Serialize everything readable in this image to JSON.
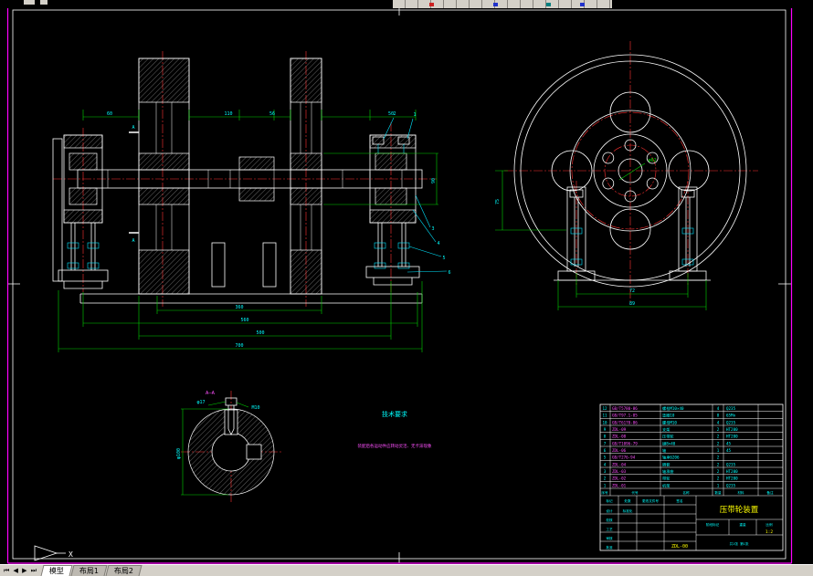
{
  "app": {
    "nav_arrows": "⏮ ◀ ▶ ⏭",
    "tabs": [
      {
        "label": "模型",
        "active": true
      },
      {
        "label": "布局1",
        "active": false
      },
      {
        "label": "布局2",
        "active": false
      }
    ]
  },
  "colors": {
    "background": "#000000",
    "frame": "#ffffff",
    "centerline": "#ff3232",
    "dimension_line": "#00d200",
    "dimension_text": "#00ffff",
    "code_text": "#ff50ff",
    "highlight_text": "#ffff00",
    "selection": "#ff00ff",
    "toolbar": "#d4d0c8"
  },
  "notes": {
    "title": "技术要求",
    "line1": "装配后各运动件应转动灵活、无卡滞现象"
  },
  "labels": {
    "section": "A",
    "section_view": "A—A",
    "ucs_axis": "X"
  },
  "dims": {
    "b1": "360",
    "b2": "560",
    "b3": "500",
    "b4": "700",
    "t1": "60",
    "t2": "110",
    "t3": "56",
    "t4": "50",
    "r1": "90",
    "e1": "72",
    "e2": "89",
    "e3": "75",
    "e4": "φ62",
    "dt1": "M10",
    "dt2": "φ17",
    "dt3": "φ100"
  },
  "balloons": [
    "1",
    "2",
    "3",
    "4",
    "5",
    "6"
  ],
  "bom": {
    "header": {
      "no": "序号",
      "code": "代号",
      "name": "名称",
      "qty": "数量",
      "mat": "材料",
      "rem": "备注"
    },
    "rows": [
      {
        "no": "12",
        "code": "GB/T5780-86",
        "name": "螺栓M10×40",
        "qty": "4",
        "mat": "Q235"
      },
      {
        "no": "11",
        "code": "GB/T97.1-85",
        "name": "垫圈10",
        "qty": "8",
        "mat": "65Mn"
      },
      {
        "no": "10",
        "code": "GB/T6170-86",
        "name": "螺母M10",
        "qty": "4",
        "mat": "Q235"
      },
      {
        "no": "9",
        "code": "ZDL-09",
        "name": "支架",
        "qty": "2",
        "mat": "HT200"
      },
      {
        "no": "8",
        "code": "ZDL-08",
        "name": "压带轮",
        "qty": "2",
        "mat": "HT200"
      },
      {
        "no": "7",
        "code": "GB/T1096-79",
        "name": "键8×40",
        "qty": "2",
        "mat": "45"
      },
      {
        "no": "6",
        "code": "ZDL-06",
        "name": "轴",
        "qty": "1",
        "mat": "45"
      },
      {
        "no": "5",
        "code": "GB/T276-94",
        "name": "轴承6206",
        "qty": "2",
        "mat": ""
      },
      {
        "no": "4",
        "code": "ZDL-04",
        "name": "隔套",
        "qty": "2",
        "mat": "Q235"
      },
      {
        "no": "3",
        "code": "ZDL-03",
        "name": "轴承座",
        "qty": "2",
        "mat": "HT200"
      },
      {
        "no": "2",
        "code": "ZDL-02",
        "name": "带轮",
        "qty": "2",
        "mat": "HT200"
      },
      {
        "no": "1",
        "code": "ZDL-01",
        "name": "机架",
        "qty": "1",
        "mat": "Q235"
      }
    ]
  },
  "titleblock": {
    "title": "压带轮装置",
    "code": "ZDL-00",
    "scale_label": "比例",
    "scale": "1:2",
    "weight_label": "重量",
    "stage_label": "阶段标记",
    "sheet": "共1张 第1张",
    "sig": {
      "r1": "标记",
      "r2": "处数",
      "r3": "更改文件号",
      "r4": "签名",
      "s1": "设计",
      "s2": "校核",
      "s3": "工艺",
      "s4": "审核",
      "s5": "标准化",
      "s6": "批准"
    }
  }
}
